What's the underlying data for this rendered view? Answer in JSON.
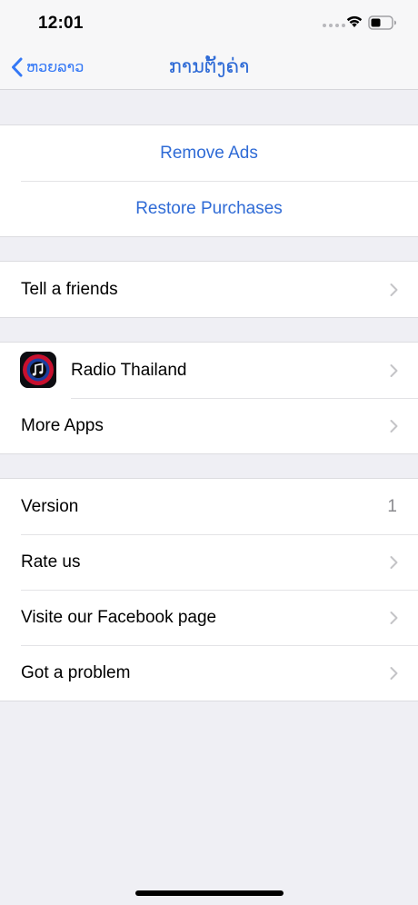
{
  "status_bar": {
    "time": "12:01"
  },
  "nav": {
    "back_label": "ຫວຍລາວ",
    "title": "ການຕັ້ງຄ່າ"
  },
  "purchases": {
    "remove_ads": "Remove Ads",
    "restore_purchases": "Restore Purchases"
  },
  "share": {
    "tell_friends": "Tell a friends"
  },
  "apps": {
    "radio_thailand": "Radio Thailand",
    "more_apps": "More Apps"
  },
  "about": {
    "version_label": "Version",
    "version_value": "1",
    "rate_us": "Rate us",
    "facebook": "Visite our Facebook page",
    "problem": "Got a problem"
  },
  "colors": {
    "accent": "#2f6bd6",
    "background": "#efeff4",
    "chevron": "#c4c4c7"
  }
}
